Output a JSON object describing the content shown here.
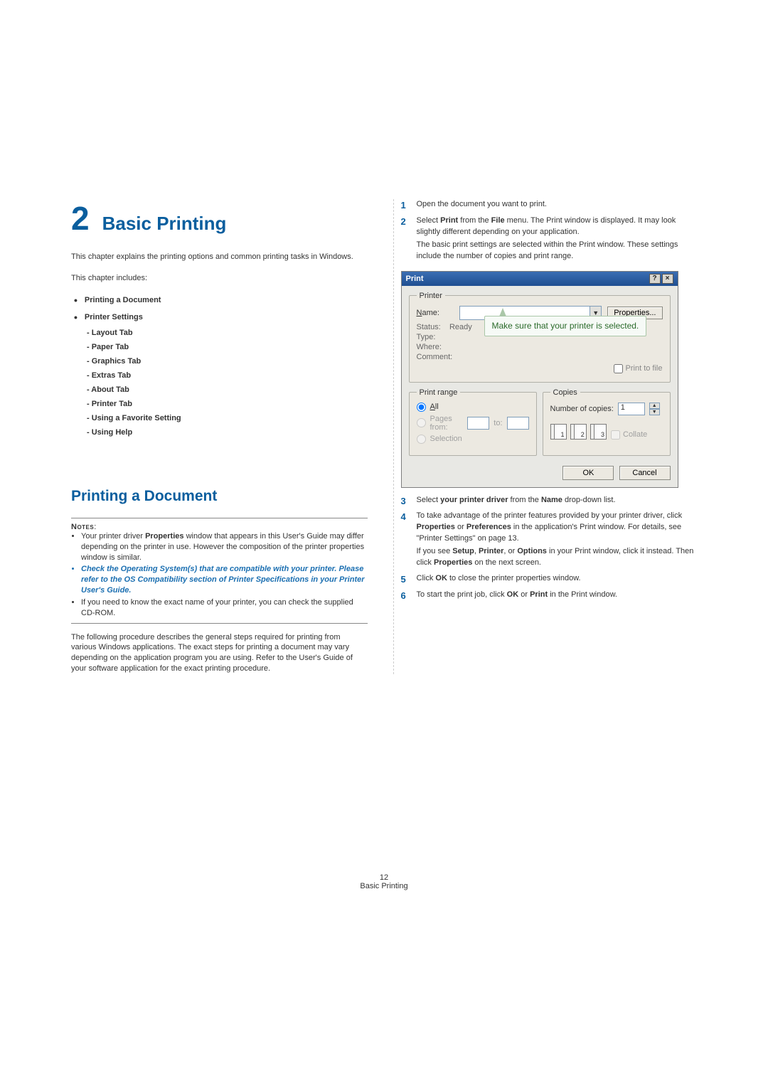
{
  "chapter": {
    "number": "2",
    "title": "Basic Printing",
    "intro1": "This chapter explains the printing options and common printing tasks in Windows.",
    "intro2": "This chapter includes:"
  },
  "toc": {
    "item1": "Printing a Document",
    "item2": "Printer Settings",
    "sub1": "- Layout Tab",
    "sub2": "- Paper Tab",
    "sub3": "- Graphics Tab",
    "sub4": "- Extras Tab",
    "sub5": "- About Tab",
    "sub6": "- Printer Tab",
    "sub7": "- Using a Favorite Setting",
    "sub8": "- Using Help"
  },
  "section": {
    "title": "Printing a Document"
  },
  "notes": {
    "label": "Notes",
    "n1_pre": "Your printer driver ",
    "n1_bold": "Properties",
    "n1_post": " window that appears in this User's Guide may differ depending on the printer in use. However the composition of the printer properties window is similar.",
    "n2": "Check the Operating System(s) that are compatible with your printer. Please refer to the OS Compatibility section of Printer Specifications in your Printer User's Guide.",
    "n3": "If you need to know the exact name of your printer, you can check the supplied CD-ROM."
  },
  "body": {
    "p1": "The following procedure describes the general steps required for printing from various Windows applications. The exact steps for printing a document may vary depending on the application program you are using. Refer to the User's Guide of your software application for the exact printing procedure."
  },
  "steps": {
    "s1": {
      "num": "1",
      "text": "Open the document you want to print."
    },
    "s2": {
      "num": "2",
      "text_pre": "Select ",
      "b1": "Print",
      "mid1": " from the ",
      "b2": "File",
      "mid2": " menu. The Print window is displayed. It may look slightly different depending on your application.",
      "para2": "The basic print settings are selected within the Print window. These settings include the number of copies and print range."
    },
    "s3": {
      "num": "3",
      "pre": "Select ",
      "b1": "your printer driver",
      "mid": " from the ",
      "b2": "Name",
      "post": " drop-down list."
    },
    "s4": {
      "num": "4",
      "pre": "To take advantage of the printer features provided by your printer driver, click ",
      "b1": "Properties",
      "mid1": " or ",
      "b2": "Preferences",
      "mid2": " in the application's Print window. For details, see \"Printer Settings\" on page 13.",
      "para2_pre": "If you see ",
      "b3": "Setup",
      "c1": ", ",
      "b4": "Printer",
      "c2": ", or ",
      "b5": "Options",
      "para2_mid": " in your Print window, click it instead. Then click ",
      "b6": "Properties",
      "para2_post": " on the next screen."
    },
    "s5": {
      "num": "5",
      "pre": "Click ",
      "b1": "OK",
      "post": " to close the printer properties window."
    },
    "s6": {
      "num": "6",
      "pre": "To start the print job, click ",
      "b1": "OK",
      "mid": " or ",
      "b2": "Print",
      "post": " in the Print window."
    }
  },
  "dialog": {
    "title": "Print",
    "help_btn": "?",
    "close_btn": "×",
    "printer_legend": "Printer",
    "name_label": "Name:",
    "properties_btn": "Properties...",
    "status_label": "Status:",
    "status_val": "Ready",
    "type_label": "Type:",
    "where_label": "Where:",
    "comment_label": "Comment:",
    "print_to_file": "Print to file",
    "callout": "Make sure that your printer is selected.",
    "range_legend": "Print range",
    "all_label": "All",
    "pages_from": "Pages  from:",
    "pages_to": "to:",
    "selection_label": "Selection",
    "copies_legend": "Copies",
    "num_copies_label": "Number of copies:",
    "num_copies_val": "1",
    "collate_label": "Collate",
    "page_num1": "1",
    "page_num2": "2",
    "page_num3": "3",
    "ok_btn": "OK",
    "cancel_btn": "Cancel"
  },
  "footer": {
    "page_num": "12",
    "section": "Basic Printing"
  }
}
